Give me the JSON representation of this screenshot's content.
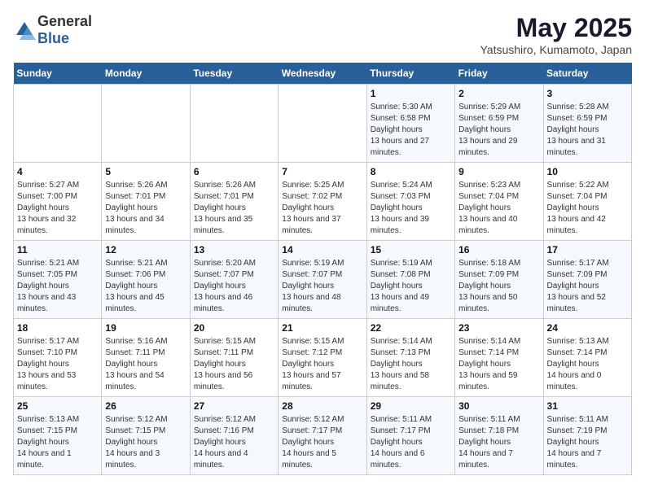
{
  "header": {
    "logo": {
      "text1": "General",
      "text2": "Blue"
    },
    "title": "May 2025",
    "subtitle": "Yatsushiro, Kumamoto, Japan"
  },
  "weekdays": [
    "Sunday",
    "Monday",
    "Tuesday",
    "Wednesday",
    "Thursday",
    "Friday",
    "Saturday"
  ],
  "weeks": [
    [
      {
        "day": "",
        "sunrise": "",
        "sunset": "",
        "daylight": ""
      },
      {
        "day": "",
        "sunrise": "",
        "sunset": "",
        "daylight": ""
      },
      {
        "day": "",
        "sunrise": "",
        "sunset": "",
        "daylight": ""
      },
      {
        "day": "",
        "sunrise": "",
        "sunset": "",
        "daylight": ""
      },
      {
        "day": "1",
        "sunrise": "5:30 AM",
        "sunset": "6:58 PM",
        "daylight": "13 hours and 27 minutes."
      },
      {
        "day": "2",
        "sunrise": "5:29 AM",
        "sunset": "6:59 PM",
        "daylight": "13 hours and 29 minutes."
      },
      {
        "day": "3",
        "sunrise": "5:28 AM",
        "sunset": "6:59 PM",
        "daylight": "13 hours and 31 minutes."
      }
    ],
    [
      {
        "day": "4",
        "sunrise": "5:27 AM",
        "sunset": "7:00 PM",
        "daylight": "13 hours and 32 minutes."
      },
      {
        "day": "5",
        "sunrise": "5:26 AM",
        "sunset": "7:01 PM",
        "daylight": "13 hours and 34 minutes."
      },
      {
        "day": "6",
        "sunrise": "5:26 AM",
        "sunset": "7:01 PM",
        "daylight": "13 hours and 35 minutes."
      },
      {
        "day": "7",
        "sunrise": "5:25 AM",
        "sunset": "7:02 PM",
        "daylight": "13 hours and 37 minutes."
      },
      {
        "day": "8",
        "sunrise": "5:24 AM",
        "sunset": "7:03 PM",
        "daylight": "13 hours and 39 minutes."
      },
      {
        "day": "9",
        "sunrise": "5:23 AM",
        "sunset": "7:04 PM",
        "daylight": "13 hours and 40 minutes."
      },
      {
        "day": "10",
        "sunrise": "5:22 AM",
        "sunset": "7:04 PM",
        "daylight": "13 hours and 42 minutes."
      }
    ],
    [
      {
        "day": "11",
        "sunrise": "5:21 AM",
        "sunset": "7:05 PM",
        "daylight": "13 hours and 43 minutes."
      },
      {
        "day": "12",
        "sunrise": "5:21 AM",
        "sunset": "7:06 PM",
        "daylight": "13 hours and 45 minutes."
      },
      {
        "day": "13",
        "sunrise": "5:20 AM",
        "sunset": "7:07 PM",
        "daylight": "13 hours and 46 minutes."
      },
      {
        "day": "14",
        "sunrise": "5:19 AM",
        "sunset": "7:07 PM",
        "daylight": "13 hours and 48 minutes."
      },
      {
        "day": "15",
        "sunrise": "5:19 AM",
        "sunset": "7:08 PM",
        "daylight": "13 hours and 49 minutes."
      },
      {
        "day": "16",
        "sunrise": "5:18 AM",
        "sunset": "7:09 PM",
        "daylight": "13 hours and 50 minutes."
      },
      {
        "day": "17",
        "sunrise": "5:17 AM",
        "sunset": "7:09 PM",
        "daylight": "13 hours and 52 minutes."
      }
    ],
    [
      {
        "day": "18",
        "sunrise": "5:17 AM",
        "sunset": "7:10 PM",
        "daylight": "13 hours and 53 minutes."
      },
      {
        "day": "19",
        "sunrise": "5:16 AM",
        "sunset": "7:11 PM",
        "daylight": "13 hours and 54 minutes."
      },
      {
        "day": "20",
        "sunrise": "5:15 AM",
        "sunset": "7:11 PM",
        "daylight": "13 hours and 56 minutes."
      },
      {
        "day": "21",
        "sunrise": "5:15 AM",
        "sunset": "7:12 PM",
        "daylight": "13 hours and 57 minutes."
      },
      {
        "day": "22",
        "sunrise": "5:14 AM",
        "sunset": "7:13 PM",
        "daylight": "13 hours and 58 minutes."
      },
      {
        "day": "23",
        "sunrise": "5:14 AM",
        "sunset": "7:14 PM",
        "daylight": "13 hours and 59 minutes."
      },
      {
        "day": "24",
        "sunrise": "5:13 AM",
        "sunset": "7:14 PM",
        "daylight": "14 hours and 0 minutes."
      }
    ],
    [
      {
        "day": "25",
        "sunrise": "5:13 AM",
        "sunset": "7:15 PM",
        "daylight": "14 hours and 1 minute."
      },
      {
        "day": "26",
        "sunrise": "5:12 AM",
        "sunset": "7:15 PM",
        "daylight": "14 hours and 3 minutes."
      },
      {
        "day": "27",
        "sunrise": "5:12 AM",
        "sunset": "7:16 PM",
        "daylight": "14 hours and 4 minutes."
      },
      {
        "day": "28",
        "sunrise": "5:12 AM",
        "sunset": "7:17 PM",
        "daylight": "14 hours and 5 minutes."
      },
      {
        "day": "29",
        "sunrise": "5:11 AM",
        "sunset": "7:17 PM",
        "daylight": "14 hours and 6 minutes."
      },
      {
        "day": "30",
        "sunrise": "5:11 AM",
        "sunset": "7:18 PM",
        "daylight": "14 hours and 7 minutes."
      },
      {
        "day": "31",
        "sunrise": "5:11 AM",
        "sunset": "7:19 PM",
        "daylight": "14 hours and 7 minutes."
      }
    ]
  ]
}
